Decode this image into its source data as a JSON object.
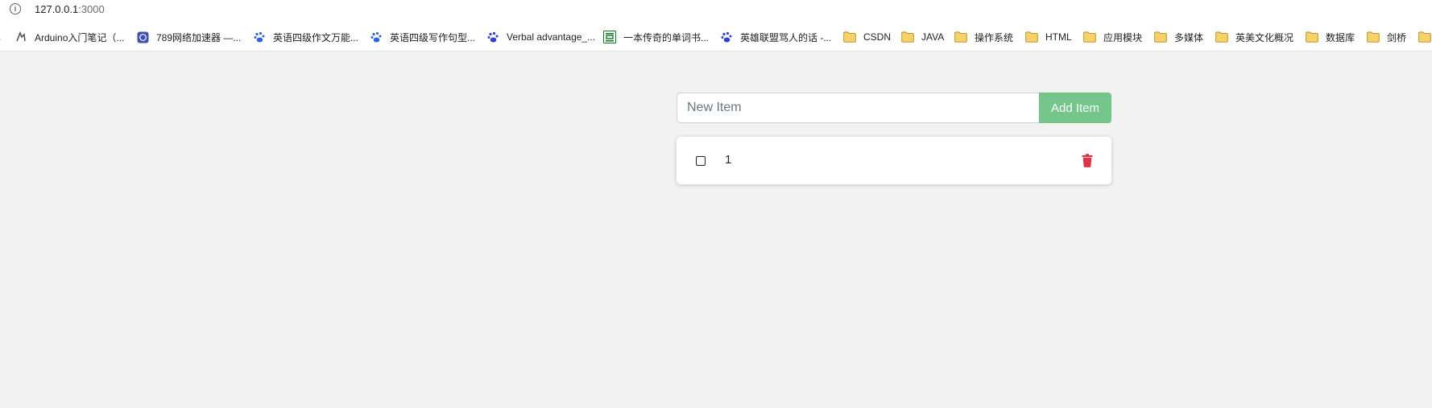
{
  "browser": {
    "address": {
      "host": "127.0.0.1",
      "port": ":3000"
    },
    "bookmarks": [
      {
        "label": ".",
        "icon": "partial-icon"
      },
      {
        "label": "Arduino入门笔记（...",
        "icon": "arduino-icon"
      },
      {
        "label": "789网络加速器 —...",
        "icon": "vpn-icon"
      },
      {
        "label": "英语四级作文万能...",
        "icon": "baidu-paw-icon"
      },
      {
        "label": "英语四级写作句型...",
        "icon": "baidu-paw-icon"
      },
      {
        "label": "Verbal advantage_...",
        "icon": "baidu-paw-icon"
      },
      {
        "label": "一本传奇的单词书...",
        "icon": "douban-icon"
      },
      {
        "label": "英雄联盟骂人的话 -...",
        "icon": "baidu-paw-icon"
      },
      {
        "label": "CSDN",
        "icon": "folder-icon"
      },
      {
        "label": "JAVA",
        "icon": "folder-icon"
      },
      {
        "label": "操作系统",
        "icon": "folder-icon"
      },
      {
        "label": "HTML",
        "icon": "folder-icon"
      },
      {
        "label": "应用模块",
        "icon": "folder-icon"
      },
      {
        "label": "多媒体",
        "icon": "folder-icon"
      },
      {
        "label": "英美文化概况",
        "icon": "folder-icon"
      },
      {
        "label": "数据库",
        "icon": "folder-icon"
      },
      {
        "label": "剑桥",
        "icon": "folder-icon"
      }
    ]
  },
  "todo": {
    "input": {
      "placeholder": "New Item",
      "value": ""
    },
    "add_label": "Add Item",
    "items": [
      {
        "text": "1",
        "checked": false
      }
    ]
  },
  "colors": {
    "background": "#f2f2f2",
    "add_button": "#74c68b",
    "delete": "#dc3545",
    "folder": "#f7d26b"
  }
}
